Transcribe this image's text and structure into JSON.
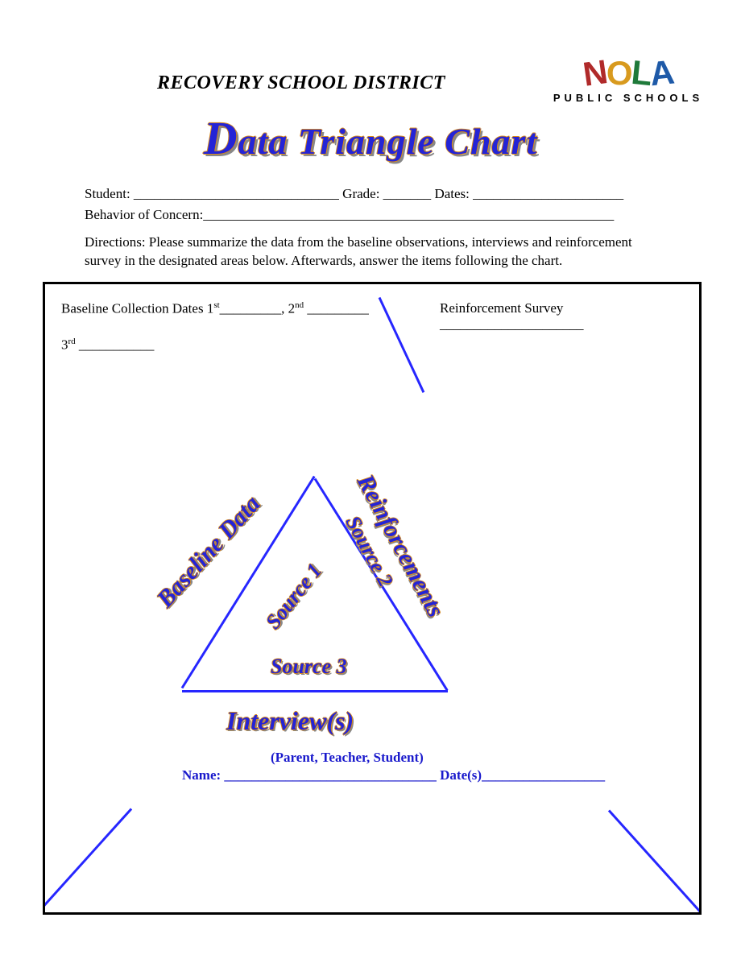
{
  "header": {
    "district": "RECOVERY SCHOOL DISTRICT",
    "logo_line": "PUBLIC SCHOOLS"
  },
  "title": "Data Triangle Chart",
  "fields": {
    "student_label": "Student: ______________________________",
    "grade_label": " Grade: _______",
    "dates_label": " Dates: ______________________",
    "behavior_label": "Behavior of Concern:____________________________________________________________"
  },
  "directions": "Directions:  Please summarize the data from the baseline observations, interviews and reinforcement survey in the designated areas below. Afterwards, answer the items following the chart.",
  "box": {
    "baseline_dates": "Baseline Collection Dates 1",
    "baseline_dates_2": "_________, 2",
    "baseline_dates_3": " _________",
    "third": "3",
    "third_tail": "  ___________",
    "reinforcement": "Reinforcement Survey _____________________"
  },
  "triangle": {
    "left": "Baseline Data",
    "right": "Reinforcements",
    "bottom": "Interview(s)",
    "source1": "Source 1",
    "source2": "Source 2",
    "source3": "Source 3",
    "sub_parent": "(Parent, Teacher, Student)",
    "sub_name": "Name: _______________________________ Date(s)__________________"
  }
}
